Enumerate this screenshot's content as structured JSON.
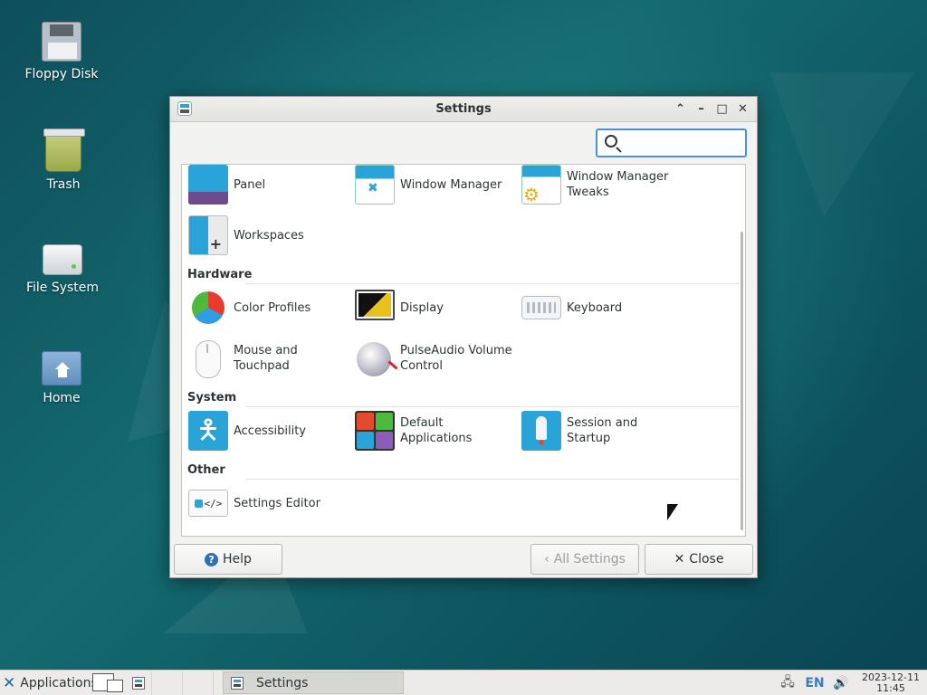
{
  "desktop": {
    "icons": [
      {
        "label": "Floppy Disk"
      },
      {
        "label": "Trash"
      },
      {
        "label": "File System"
      },
      {
        "label": "Home"
      }
    ]
  },
  "window": {
    "title": "Settings",
    "controls": {
      "shade": "⌃",
      "minimize": "–",
      "maximize": "□",
      "close": "✕"
    },
    "search": {
      "placeholder": "",
      "value": ""
    },
    "top_items": [
      {
        "label": "Panel",
        "icon": "panel-icon"
      },
      {
        "label": "Window Manager",
        "icon": "window-manager-icon"
      },
      {
        "label": "Window Manager Tweaks",
        "icon": "window-manager-tweaks-icon"
      },
      {
        "label": "Workspaces",
        "icon": "workspaces-icon"
      }
    ],
    "sections": [
      {
        "title": "Hardware",
        "items": [
          {
            "label": "Color Profiles",
            "icon": "color-profiles-icon"
          },
          {
            "label": "Display",
            "icon": "display-icon"
          },
          {
            "label": "Keyboard",
            "icon": "keyboard-icon"
          },
          {
            "label": "Mouse and Touchpad",
            "icon": "mouse-icon"
          },
          {
            "label": "PulseAudio Volume Control",
            "icon": "pulseaudio-icon"
          }
        ]
      },
      {
        "title": "System",
        "items": [
          {
            "label": "Accessibility",
            "icon": "accessibility-icon"
          },
          {
            "label": "Default Applications",
            "icon": "default-applications-icon"
          },
          {
            "label": "Session and Startup",
            "icon": "session-startup-icon"
          }
        ]
      },
      {
        "title": "Other",
        "items": [
          {
            "label": "Settings Editor",
            "icon": "settings-editor-icon"
          }
        ]
      }
    ],
    "buttons": {
      "help": "Help",
      "all_settings": "All Settings",
      "close": "Close"
    }
  },
  "taskbar": {
    "applications": "Applications",
    "window_title": "Settings",
    "keyboard_layout": "EN",
    "date": "2023-12-11",
    "time": "11:45"
  },
  "colors": {
    "accent": "#2aa3d8",
    "focus": "#4a90d9",
    "panel_purple": "#6c4c8c"
  }
}
